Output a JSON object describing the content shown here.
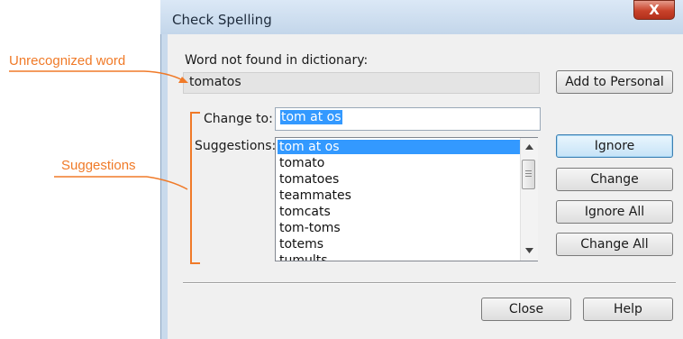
{
  "window": {
    "title": "Check Spelling",
    "close_glyph": "X"
  },
  "word_not_found": {
    "label": "Word not found in dictionary:",
    "value": "tomatos"
  },
  "change_to": {
    "label": "Change to:",
    "value": "tom at os"
  },
  "suggestions": {
    "label": "Suggestions:",
    "selected": "tom at os",
    "items": [
      "tom at os",
      "tomato",
      "tomatoes",
      "teammates",
      "tomcats",
      "tom-toms",
      "totems",
      "tumults"
    ]
  },
  "buttons": {
    "add_to_personal": "Add to Personal",
    "ignore": "Ignore",
    "change": "Change",
    "ignore_all": "Ignore All",
    "change_all": "Change All",
    "close": "Close",
    "help": "Help"
  },
  "annotations": {
    "unrecognized": "Unrecognized word",
    "suggestions": "Suggestions"
  },
  "colors": {
    "callout": "#f07a28",
    "selection": "#3399ff"
  },
  "icons": {
    "close": "close-icon",
    "scroll_up": "chevron-up-icon",
    "scroll_down": "chevron-down-icon"
  }
}
